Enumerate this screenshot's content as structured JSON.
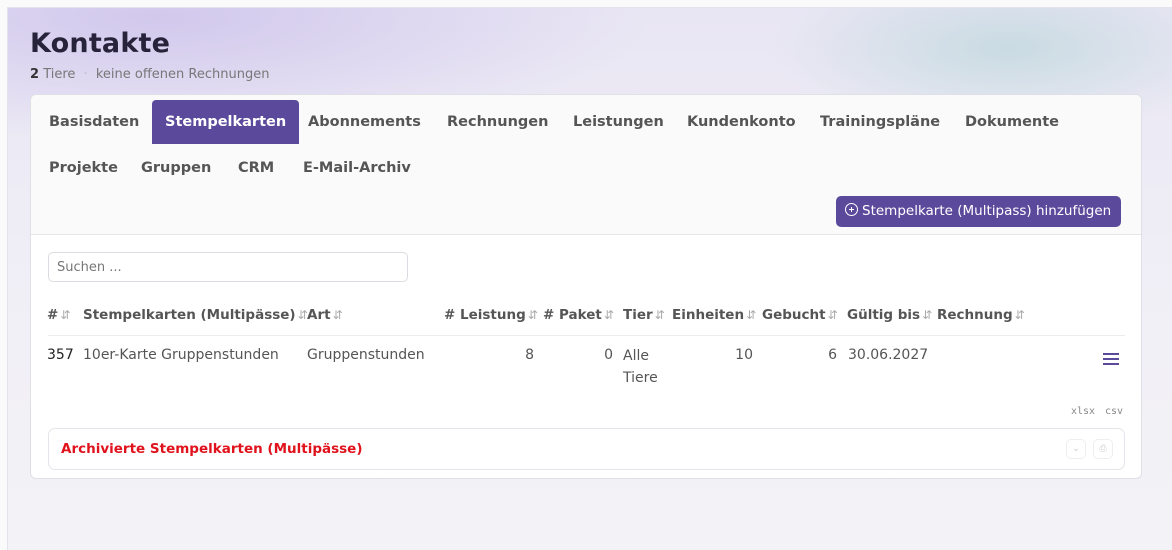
{
  "page": {
    "title": "Kontakte",
    "count": "2",
    "count_label": "Tiere",
    "invoices_status": "keine offenen Rechnungen"
  },
  "tabs": [
    {
      "label": "Basisdaten",
      "active": false
    },
    {
      "label": "Stempelkarten",
      "active": true
    },
    {
      "label": "Abonnements",
      "active": false
    },
    {
      "label": "Rechnungen",
      "active": false
    },
    {
      "label": "Leistungen",
      "active": false
    },
    {
      "label": "Kundenkonto",
      "active": false
    },
    {
      "label": "Trainingspläne",
      "active": false
    },
    {
      "label": "Dokumente",
      "active": false
    },
    {
      "label": "Projekte",
      "active": false
    },
    {
      "label": "Gruppen",
      "active": false
    },
    {
      "label": "CRM",
      "active": false
    },
    {
      "label": "E-Mail-Archiv",
      "active": false
    }
  ],
  "toolbar": {
    "add_label": "Stempelkarte (Multipass) hinzufügen",
    "add_icon": "plus-circle-icon"
  },
  "search": {
    "placeholder": "Suchen ...",
    "value": ""
  },
  "table": {
    "sort_glyph": "⇵",
    "columns": [
      "#",
      "Stempelkarten (Multipässe)",
      "Art",
      "# Leistung",
      "# Paket",
      "Tier",
      "Einheiten",
      "Gebucht",
      "Gültig bis",
      "Rechnung"
    ],
    "rows": [
      {
        "id": "357",
        "name": "10er-Karte Gruppenstunden",
        "art": "Gruppenstunden",
        "leistung": "8",
        "paket": "0",
        "tier_line1": "Alle",
        "tier_line2": "Tiere",
        "einheiten": "10",
        "gebucht": "6",
        "gueltig_bis": "30.06.2027",
        "rechnung": "",
        "menu_icon": "hamburger-menu-icon"
      }
    ]
  },
  "exports": {
    "xlsx": "xlsx",
    "csv": "csv"
  },
  "archive": {
    "title": "Archivierte Stempelkarten (Multipässe)"
  },
  "colors": {
    "accent": "#5b4a9c",
    "danger": "#e0121b",
    "title": "#26233a"
  }
}
